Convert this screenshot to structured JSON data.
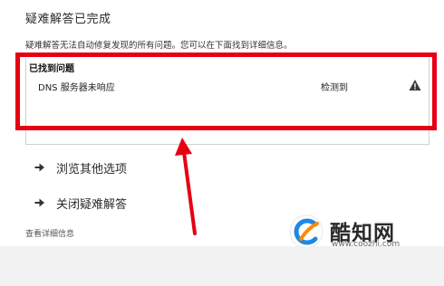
{
  "header": {
    "title": "疑难解答已完成",
    "description": "疑难解答无法自动修复发现的所有问题。您可以在下面找到详细信息。"
  },
  "issues_panel": {
    "label": "已找到问题",
    "issues": [
      {
        "name": "DNS 服务器未响应",
        "status": "检测到",
        "icon": "warning-icon"
      }
    ]
  },
  "options": [
    {
      "label": "浏览其他选项",
      "icon": "arrow-right-icon"
    },
    {
      "label": "关闭疑难解答",
      "icon": "arrow-right-icon"
    }
  ],
  "details_link": "查看详细信息",
  "annotation": {
    "highlight_color": "#e60012"
  },
  "watermark": {
    "name": "酷知网",
    "url": "www.coozhi.com"
  }
}
